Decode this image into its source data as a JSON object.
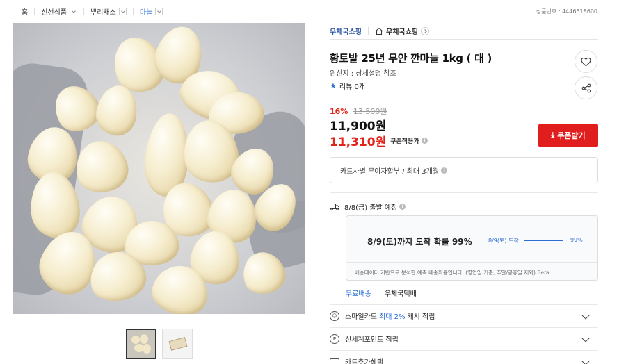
{
  "breadcrumb": {
    "home": "홈",
    "items": [
      "신선식품",
      "뿌리채소",
      "마늘"
    ]
  },
  "product_number": "상품번호 : 4446518600",
  "seller": {
    "link": "우체국쇼핑",
    "store": "우체국쇼핑"
  },
  "product": {
    "title": "황토밭 25년 무안 깐마늘 1kg ( 대 )",
    "origin": "원산지 : 상세설명 참조",
    "review_label": "리뷰 0개"
  },
  "pricing": {
    "discount_rate": "16%",
    "original_price": "13,500원",
    "price": "11,900원",
    "coupon_price": "11,310원",
    "coupon_applied_label": "쿠폰적용가",
    "coupon_button": "쿠폰받기"
  },
  "installment": "카드사별 무이자할부 / 최대 3개월",
  "shipping": {
    "dispatch": "8/8(금) 출발 예정",
    "prediction_main": "8/9(토)까지 도착 확률 99%",
    "prediction_date": "8/9(토) 도착",
    "prediction_pct": "99%",
    "prediction_value": 0.99,
    "prediction_note": "배송데이터 기반으로 분석한 예측 배송확률입니다. (영업일 기준, 주말/공휴일 제외)",
    "beta": "Beta",
    "free_shipping": "무료배송",
    "carrier": "우체국택배"
  },
  "benefits": [
    {
      "pre": "스마일카드",
      "highlight": "최대 2%",
      "post": "캐시 적립",
      "icon": "smile-card-icon"
    },
    {
      "pre": "신세계포인트 적립",
      "highlight": "",
      "post": "",
      "icon": "point-icon"
    },
    {
      "pre": "카드추가혜택",
      "highlight": "",
      "post": "",
      "icon": "card-icon"
    }
  ],
  "colors": {
    "accent_red": "#e01e1e",
    "accent_blue": "#2b6fd6"
  }
}
